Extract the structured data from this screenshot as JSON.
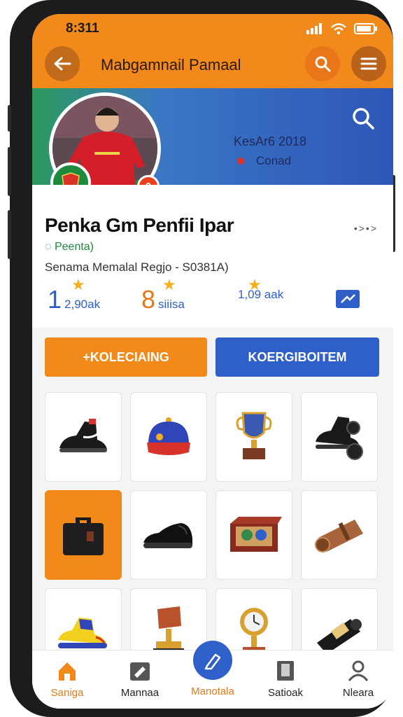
{
  "status_bar": {
    "time": "8:311"
  },
  "app_bar": {
    "title": "Mabgamnail Pamaal"
  },
  "banner": {
    "line1": "KesAr6 2018",
    "line2": "Conad",
    "avatar_number": "0"
  },
  "profile": {
    "name": "Penka Gm Penfii Ipar",
    "more_label": "•>•>",
    "subtitle": "Peenta)",
    "description": "Senama Memalal Regjo - S0381A)"
  },
  "stats": [
    {
      "big": "1",
      "small": "2,90ak"
    },
    {
      "big": "8",
      "small": "siiisa"
    },
    {
      "big": "",
      "small": "1,09 aak"
    }
  ],
  "actions": {
    "primary": "+KOLECIAING",
    "secondary": "KOERGIBOITEM"
  },
  "items": [
    "black-football-boot",
    "blue-cap",
    "trophy",
    "black-roller-skate",
    "black-case",
    "black-shoe",
    "collector-box",
    "bronze-scope",
    "yellow-sneaker",
    "bronze-trophy",
    "clock-trophy",
    "black-cylinder"
  ],
  "bottom_nav": [
    {
      "label": "Saniga",
      "active": true
    },
    {
      "label": "Mannaa",
      "active": false
    },
    {
      "label": "Manotala",
      "active": false
    },
    {
      "label": "Satioak",
      "active": false
    },
    {
      "label": "Nleara",
      "active": false
    }
  ],
  "colors": {
    "accent": "#f28a1b",
    "brand_blue": "#2f5fc8",
    "green": "#1e8a3c"
  }
}
